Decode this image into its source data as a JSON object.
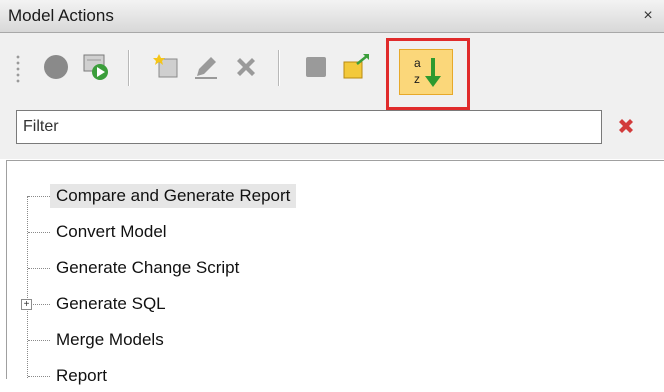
{
  "window": {
    "title": "Model Actions",
    "close_glyph": "×"
  },
  "toolbar": {
    "buttons": [
      {
        "name": "record-icon"
      },
      {
        "name": "run-icon"
      },
      {
        "name": "new-icon"
      },
      {
        "name": "edit-icon"
      },
      {
        "name": "delete-icon"
      },
      {
        "name": "stop-icon"
      },
      {
        "name": "export-icon"
      },
      {
        "name": "sort-az-icon",
        "active": true
      }
    ],
    "sort_glyph_a": "a",
    "sort_glyph_z": "z"
  },
  "filter": {
    "placeholder": "Filter",
    "value": ""
  },
  "tree": {
    "items": [
      {
        "label": "Compare and Generate Report",
        "selected": true
      },
      {
        "label": "Convert Model"
      },
      {
        "label": "Generate Change Script"
      },
      {
        "label": "Generate SQL",
        "expandable": true,
        "expander_glyph": "+"
      },
      {
        "label": "Merge Models"
      },
      {
        "label": "Report"
      }
    ]
  },
  "colors": {
    "highlight_border": "#e02b2b",
    "active_button_fill": "#fbd77a",
    "selection": "#e6e6e6"
  }
}
